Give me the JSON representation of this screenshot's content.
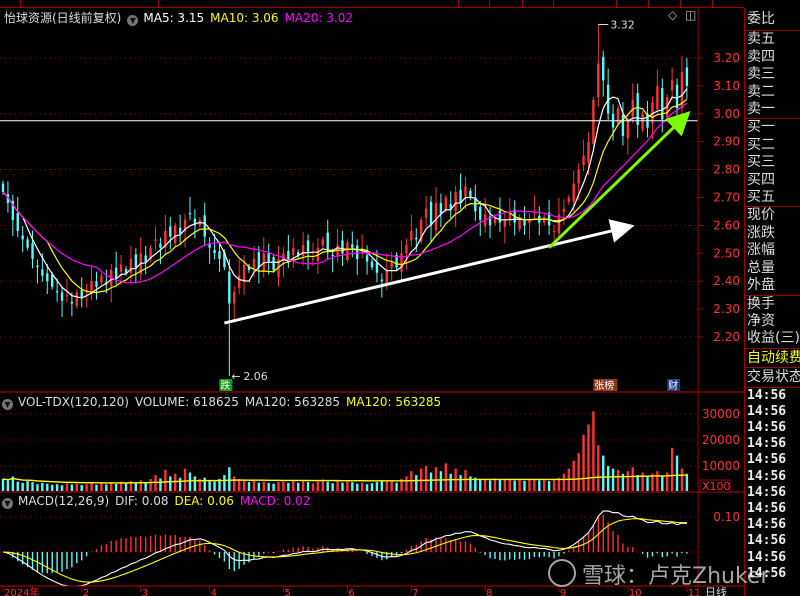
{
  "header": {
    "stock": "怡球资源(日线前复权)",
    "ma5": "MA5: 3.15",
    "ma10": "MA10: 3.06",
    "ma20": "MA20: 3.02"
  },
  "volume_header": {
    "title": "VOL-TDX(120,120)",
    "volume": "VOLUME: 618625",
    "ma120_white": "MA120: 563285",
    "ma120_yellow": "MA120: 563285"
  },
  "macd_header": {
    "title": "MACD(12,26,9)",
    "dif": "DIF: 0.08",
    "dea": "DEA: 0.06",
    "macd": "MACD: 0.02"
  },
  "right_panel": {
    "weibi": "委比",
    "sell": [
      "卖五",
      "卖四",
      "卖三",
      "卖二",
      "卖一"
    ],
    "buy": [
      "买一",
      "买二",
      "买三",
      "买四",
      "买五"
    ],
    "quote": [
      "现价",
      "涨跌",
      "涨幅",
      "总量",
      "外盘"
    ],
    "fund": [
      "换手",
      "净资",
      "收益(三)"
    ],
    "auto_renew": "自动续费",
    "trade_status": "交易状态",
    "time_rows": [
      "14:56",
      "14:56",
      "14:56",
      "14:56",
      "14:56",
      "14:56",
      "14:56",
      "14:56",
      "14:56",
      "14:56",
      "14:56",
      "14:56"
    ]
  },
  "watermark": "雪球：卢克Zhuker",
  "colors": {
    "up": "#ff3232",
    "down": "#54fcfc",
    "ma5": "#ffffff",
    "ma10": "#ffff00",
    "ma20": "#ff00ff",
    "grid": "#a00000",
    "axis_text": "#ff3030",
    "trend_white": "#ffffff",
    "trend_green": "#7cfc00"
  },
  "chart_data": {
    "type": "candlestick",
    "title": "怡球资源(日线前复权)",
    "price_ticks": [
      "3.20",
      "3.10",
      "3.00",
      "2.90",
      "2.80",
      "2.70",
      "2.60",
      "2.50",
      "2.40",
      "2.30",
      "2.20"
    ],
    "price_range": [
      2.06,
      3.32
    ],
    "x_ticks": [
      {
        "label": "2024年",
        "index": 0
      },
      {
        "label": "2",
        "index": 16
      },
      {
        "label": "3",
        "index": 28
      },
      {
        "label": "4",
        "index": 42
      },
      {
        "label": "5",
        "index": 57
      },
      {
        "label": "6",
        "index": 70
      },
      {
        "label": "7",
        "index": 83
      },
      {
        "label": "8",
        "index": 98
      },
      {
        "label": "9",
        "index": 113
      },
      {
        "label": "10",
        "index": 127
      },
      {
        "label": "11",
        "index": 139
      }
    ],
    "period_label": "日线",
    "close": [
      2.72,
      2.68,
      2.62,
      2.58,
      2.55,
      2.52,
      2.48,
      2.45,
      2.42,
      2.4,
      2.38,
      2.36,
      2.33,
      2.35,
      2.32,
      2.36,
      2.34,
      2.37,
      2.4,
      2.38,
      2.42,
      2.39,
      2.44,
      2.41,
      2.46,
      2.43,
      2.48,
      2.45,
      2.5,
      2.47,
      2.52,
      2.55,
      2.52,
      2.58,
      2.56,
      2.6,
      2.57,
      2.62,
      2.64,
      2.6,
      2.62,
      2.56,
      2.52,
      2.5,
      2.48,
      2.45,
      2.32,
      2.36,
      2.42,
      2.46,
      2.44,
      2.48,
      2.45,
      2.5,
      2.47,
      2.44,
      2.48,
      2.5,
      2.47,
      2.52,
      2.49,
      2.53,
      2.5,
      2.48,
      2.52,
      2.55,
      2.51,
      2.49,
      2.53,
      2.5,
      2.54,
      2.52,
      2.48,
      2.51,
      2.47,
      2.45,
      2.43,
      2.4,
      2.44,
      2.47,
      2.45,
      2.5,
      2.53,
      2.58,
      2.55,
      2.62,
      2.66,
      2.6,
      2.68,
      2.64,
      2.7,
      2.66,
      2.72,
      2.68,
      2.74,
      2.7,
      2.65,
      2.62,
      2.64,
      2.6,
      2.63,
      2.61,
      2.62,
      2.64,
      2.61,
      2.63,
      2.6,
      2.62,
      2.65,
      2.61,
      2.63,
      2.6,
      2.58,
      2.64,
      2.66,
      2.7,
      2.75,
      2.8,
      2.85,
      2.9,
      3.05,
      3.18,
      3.12,
      3.0,
      2.95,
      3.02,
      2.92,
      2.98,
      3.05,
      2.96,
      3.0,
      2.95,
      3.04,
      3.1,
      2.98,
      3.06,
      3.12,
      3.02,
      3.15,
      3.1
    ],
    "volume": [
      5000,
      4500,
      6000,
      4000,
      3500,
      4200,
      3800,
      3000,
      3500,
      3200,
      2800,
      3000,
      2600,
      3400,
      2900,
      3100,
      2700,
      3000,
      3600,
      2800,
      3300,
      2900,
      3800,
      3100,
      4000,
      3400,
      4200,
      3600,
      4500,
      3800,
      5000,
      6500,
      5200,
      8500,
      6000,
      7000,
      5500,
      9000,
      7500,
      6000,
      5000,
      5500,
      4500,
      4000,
      5000,
      6500,
      9500,
      6000,
      5000,
      4200,
      3800,
      4500,
      3600,
      4000,
      3500,
      3200,
      3800,
      4000,
      3500,
      4200,
      3600,
      4500,
      3800,
      3300,
      4000,
      4800,
      3900,
      3400,
      4100,
      3600,
      4400,
      3800,
      3200,
      3600,
      3000,
      3400,
      3800,
      4500,
      4000,
      4200,
      3600,
      5000,
      6000,
      8000,
      6500,
      9000,
      10000,
      7500,
      9500,
      8000,
      11000,
      7000,
      9000,
      6500,
      8500,
      6000,
      5500,
      5000,
      4800,
      4500,
      5200,
      4600,
      4800,
      5000,
      4400,
      4700,
      4300,
      4600,
      5000,
      4500,
      4800,
      4200,
      4600,
      5500,
      7000,
      9000,
      12000,
      15000,
      22000,
      26000,
      31000,
      18000,
      14000,
      10000,
      9000,
      8500,
      7000,
      8000,
      9500,
      6500,
      7500,
      6000,
      7000,
      8000,
      6000,
      7500,
      17000,
      14000,
      9000,
      7000
    ],
    "volume_ticks": [
      "30000",
      "20000",
      "10000"
    ],
    "volume_unit": "X100",
    "macd_ticks": [
      "0.10"
    ],
    "annotations": {
      "high": {
        "label": "3.32",
        "value": 3.32,
        "index": 121
      },
      "low": {
        "label": "2.06",
        "value": 2.06,
        "index": 46
      }
    },
    "markers": [
      {
        "label": "跌",
        "index": 45,
        "color": "#1a9a1a"
      },
      {
        "label": "张榜",
        "index": 121,
        "color": "#8a3a1a"
      },
      {
        "label": "财",
        "index": 136,
        "color": "#1a3a7a"
      }
    ],
    "reference_line": 2.975,
    "trend_lines": [
      {
        "name": "white-trend",
        "from": [
          45,
          2.25
        ],
        "to": [
          126,
          2.59
        ]
      },
      {
        "name": "green-trend",
        "from": [
          111,
          2.52
        ],
        "to": [
          138,
          2.98
        ]
      }
    ]
  }
}
